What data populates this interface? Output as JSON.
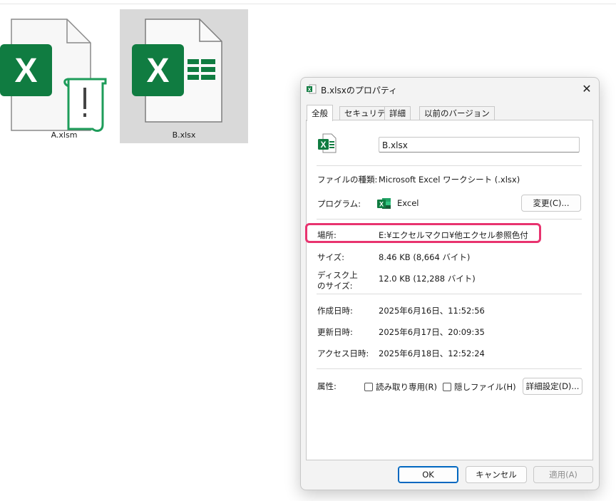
{
  "explorer": {
    "files": [
      {
        "name": "A.xlsm",
        "icon": "excel-macro-file-icon",
        "selected": false
      },
      {
        "name": "B.xlsx",
        "icon": "excel-file-icon",
        "selected": true
      }
    ]
  },
  "dialog": {
    "title": "B.xlsxのプロパティ",
    "close_glyph": "✕",
    "tabs": [
      "全般",
      "セキュリティ",
      "詳細",
      "以前のバージョン"
    ],
    "active_tab": "全般",
    "filename": "B.xlsx",
    "rows": {
      "type": {
        "label": "ファイルの種類:",
        "value": "Microsoft Excel ワークシート (.xlsx)"
      },
      "program": {
        "label": "プログラム:",
        "value": "Excel",
        "change_button": "変更(C)..."
      },
      "location": {
        "label": "場所:",
        "value": "E:¥エクセルマクロ¥他エクセル参照色付"
      },
      "size": {
        "label": "サイズ:",
        "value": "8.46 KB (8,664 バイト)"
      },
      "disk_size": {
        "label_line1": "ディスク上",
        "label_line2": "のサイズ:",
        "value": "12.0 KB (12,288 バイト)"
      },
      "created": {
        "label": "作成日時:",
        "value": "2025年6月16日、11:52:56"
      },
      "modified": {
        "label": "更新日時:",
        "value": "2025年6月17日、20:09:35"
      },
      "accessed": {
        "label": "アクセス日時:",
        "value": "2025年6月18日、12:52:24"
      },
      "attributes": {
        "label": "属性:",
        "readonly": "読み取り専用(R)",
        "hidden": "隠しファイル(H)",
        "advanced_button": "詳細設定(D)..."
      }
    },
    "buttons": {
      "ok": "OK",
      "cancel": "キャンセル",
      "apply": "適用(A)"
    }
  },
  "colors": {
    "excel_green": "#107c41",
    "highlight": "#e8336f",
    "accent": "#0067c0"
  }
}
